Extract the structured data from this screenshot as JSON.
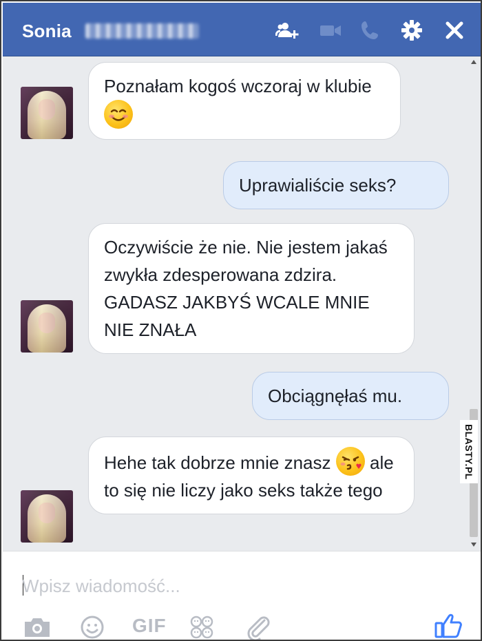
{
  "header": {
    "contact_name": "Sonia",
    "icons": [
      "add-person-icon",
      "video-call-icon",
      "phone-icon",
      "gear-icon",
      "close-icon"
    ]
  },
  "messages": [
    {
      "side": "incoming",
      "text": "Poznałam kogoś wczoraj w klubie",
      "emoji": "smiling-face"
    },
    {
      "side": "outgoing",
      "text": "Uprawialiście seks?"
    },
    {
      "side": "incoming",
      "text": "Oczywiście że nie. Nie jestem jakaś zwykła zdesperowana zdzira. GADASZ JAKBYŚ WCALE MNIE NIE ZNAŁA"
    },
    {
      "side": "outgoing",
      "text": "Obciągnęłaś mu."
    },
    {
      "side": "incoming",
      "text_before": "Hehe tak dobrze mnie znasz",
      "emoji": "face-blowing-kiss",
      "text_after": "ale to się nie liczy jako seks także tego"
    }
  ],
  "composer": {
    "placeholder": "Wpisz wiadomość...",
    "icons": [
      "camera-icon",
      "emoji-icon",
      "gif-icon",
      "stickers-icon",
      "attach-icon",
      "like-icon"
    ],
    "gif_label": "GIF"
  },
  "watermark": "BLASTY.PL",
  "colors": {
    "header": "#4267b2",
    "chat_bg": "#e9ebee",
    "outgoing_bubble": "#e1ecfb",
    "incoming_bubble": "#ffffff",
    "like": "#4080ff"
  }
}
